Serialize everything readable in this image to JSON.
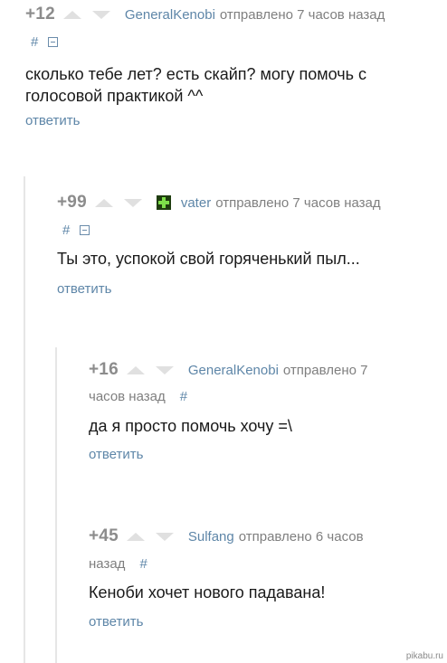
{
  "comments": [
    {
      "rating": "+12",
      "author": "GeneralKenobi",
      "sent": "отправлено 7 часов назад",
      "hash": "#",
      "text_lines": [
        "сколько тебе лет? есть скайп? могу помочь с",
        "голосовой практикой ^^"
      ],
      "reply": "ответить"
    },
    {
      "rating": "+99",
      "author": "vater",
      "avatar_icon": "green-plus-avatar",
      "sent": "отправлено 7 часов назад",
      "hash": "#",
      "text_lines": [
        "Ты это, успокой свой горяченький пыл..."
      ],
      "reply": "ответить"
    },
    {
      "rating": "+16",
      "author": "GeneralKenobi",
      "sent_line1": "отправлено 7",
      "sent_line2": "часов назад",
      "hash": "#",
      "text_lines": [
        "да я просто помочь хочу =\\"
      ],
      "reply": "ответить"
    },
    {
      "rating": "+45",
      "author": "Sulfang",
      "sent_line1": "отправлено 6 часов",
      "sent_line2": "назад",
      "hash": "#",
      "text_lines": [
        "Кеноби хочет нового падавана!"
      ],
      "reply": "ответить"
    }
  ],
  "watermark": "pikabu.ru",
  "colors": {
    "link": "#5e86a8",
    "meta": "#7f7f7f",
    "rating": "#8c8c8c",
    "arrow": "#e0e0e0",
    "thread_line": "#e6e6e6"
  }
}
